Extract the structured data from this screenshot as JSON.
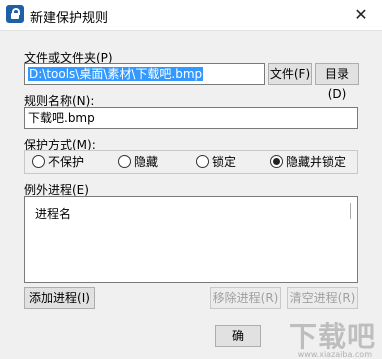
{
  "window": {
    "title": "新建保护规则",
    "close_glyph": "✕"
  },
  "file_section": {
    "label": "文件或文件夹(P)",
    "path_value": "D:\\tools\\桌面\\素材\\下载吧.bmp",
    "file_button": "文件(F)",
    "dir_button": "目录(D)"
  },
  "rule_name": {
    "label": "规则名称(N):",
    "value": "下载吧.bmp"
  },
  "protect_mode": {
    "label": "保护方式(M):",
    "options": [
      {
        "label": "不保护",
        "selected": false
      },
      {
        "label": "隐藏",
        "selected": false
      },
      {
        "label": "锁定",
        "selected": false
      },
      {
        "label": "隐藏并锁定",
        "selected": true
      }
    ]
  },
  "exceptions": {
    "label": "例外进程(E)",
    "column_header": "进程名",
    "add_button": "添加进程(I)",
    "remove_button": "移除进程(R)",
    "clear_button": "清空进程(R)"
  },
  "footer": {
    "ok_partial": "确"
  },
  "watermark": {
    "text": "下载吧",
    "url": "www.xiazaiba.com"
  }
}
